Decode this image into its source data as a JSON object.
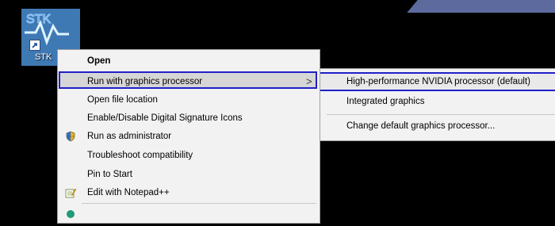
{
  "desktop": {
    "icon": {
      "label": "STK",
      "icon_name": "stk-app-icon",
      "shortcut_icon": "shortcut-arrow-icon"
    }
  },
  "context_menu": {
    "items": [
      {
        "label": "Open",
        "bold": true
      },
      {
        "label": "Run with graphics processor",
        "highlighted": true,
        "submenu_arrow": ">"
      },
      {
        "label": "Open file location"
      },
      {
        "label": "Enable/Disable Digital Signature Icons"
      },
      {
        "label": "Run as administrator",
        "icon": "uac-shield-icon"
      },
      {
        "label": "Troubleshoot compatibility"
      },
      {
        "label": "Pin to Start"
      },
      {
        "label": "Edit with Notepad++",
        "icon": "notepad-plus-plus-icon"
      },
      {
        "label": "",
        "icon": "partially-visible-icon"
      }
    ]
  },
  "submenu": {
    "items": [
      {
        "label": "High-performance NVIDIA processor (default)",
        "highlighted": true
      },
      {
        "label": "Integrated graphics"
      },
      {
        "label": "Change default graphics processor..."
      }
    ]
  },
  "colors": {
    "highlight_border": "#2020c8",
    "menu_background": "#f2f2f2",
    "desktop_background": "#000000"
  }
}
